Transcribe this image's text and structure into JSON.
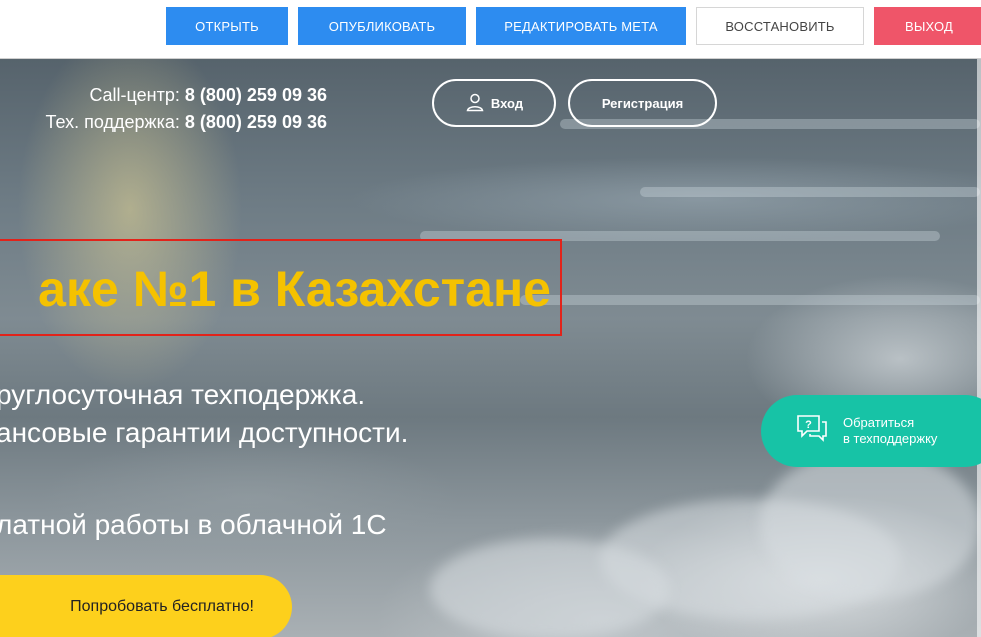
{
  "toolbar": {
    "open": "ОТКРЫТЬ",
    "publish": "ОПУБЛИКОВАТЬ",
    "edit_meta": "РЕДАКТИРОВАТЬ МЕТА",
    "restore": "ВОССТАНОВИТЬ",
    "logout": "ВЫХОД"
  },
  "contacts": {
    "callcenter_label": "Call-центр:",
    "callcenter_phone": "8 (800) 259 09 36",
    "support_label": "Тех. поддержка:",
    "support_phone": "8 (800) 259 09 36"
  },
  "auth": {
    "login": "Вход",
    "register": "Регистрация"
  },
  "hero": {
    "headline": "аке №1 в Казахстане",
    "line1": "руглосуточная техподержка.",
    "line2": "ансовые гарантии доступности.",
    "line3": "латной работы в облачной 1С",
    "try_button": "Попробовать бесплатно!"
  },
  "support": {
    "line1": "Обратиться",
    "line2": "в техподдержку"
  },
  "colors": {
    "toolbar_blue": "#2d8cf0",
    "toolbar_red": "#ef5569",
    "headline_yellow": "#f5c200",
    "support_green": "#17c3a6",
    "try_yellow": "#fdd01c",
    "highlight_red": "#e2231a"
  }
}
